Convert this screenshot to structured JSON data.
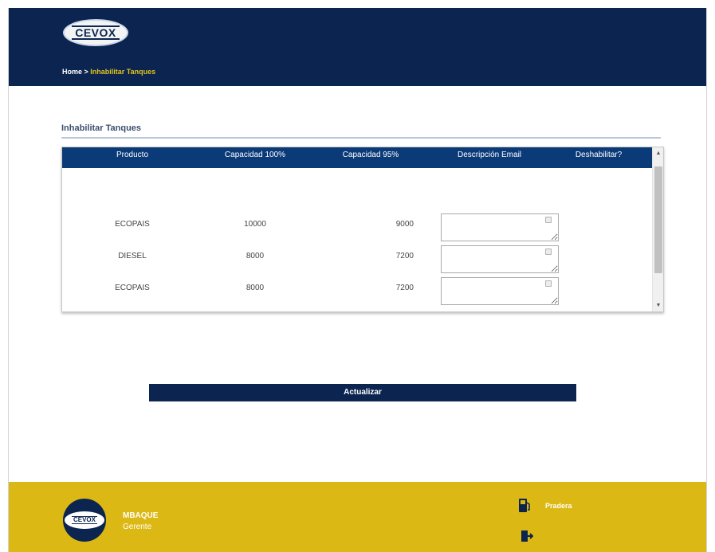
{
  "header": {
    "logo_text": "CEVOX",
    "breadcrumb": {
      "home": "Home",
      "separator": " > ",
      "current": "Inhabilitar Tanques"
    }
  },
  "section": {
    "title": "Inhabilitar Tanques"
  },
  "table": {
    "columns": [
      "Producto",
      "Capacidad 100%",
      "Capacidad 95%",
      "Descripción Email",
      "Deshabilitar?"
    ],
    "rows": [
      {
        "producto": "ECOPAIS",
        "cap100": "10000",
        "cap95": "9000",
        "email": "",
        "deshabilitar": false
      },
      {
        "producto": "DIESEL",
        "cap100": "8000",
        "cap95": "7200",
        "email": "",
        "deshabilitar": false
      },
      {
        "producto": "ECOPAIS",
        "cap100": "8000",
        "cap95": "7200",
        "email": "",
        "deshabilitar": false
      }
    ]
  },
  "actions": {
    "update_label": "Actualizar"
  },
  "footer": {
    "logo_text": "CEVOX",
    "user_name": "MBAQUE",
    "user_role": "Gerente",
    "station_label": "Pradera"
  },
  "colors": {
    "navy": "#0b2550",
    "table_header": "#0b3a78",
    "gold": "#dcb814",
    "breadcrumb_current": "#e2c21c"
  },
  "icons": {
    "station": "gas-pump-icon",
    "logout": "logout-door-icon",
    "scroll_up": "arrow-up-icon",
    "scroll_down": "arrow-down-icon"
  }
}
